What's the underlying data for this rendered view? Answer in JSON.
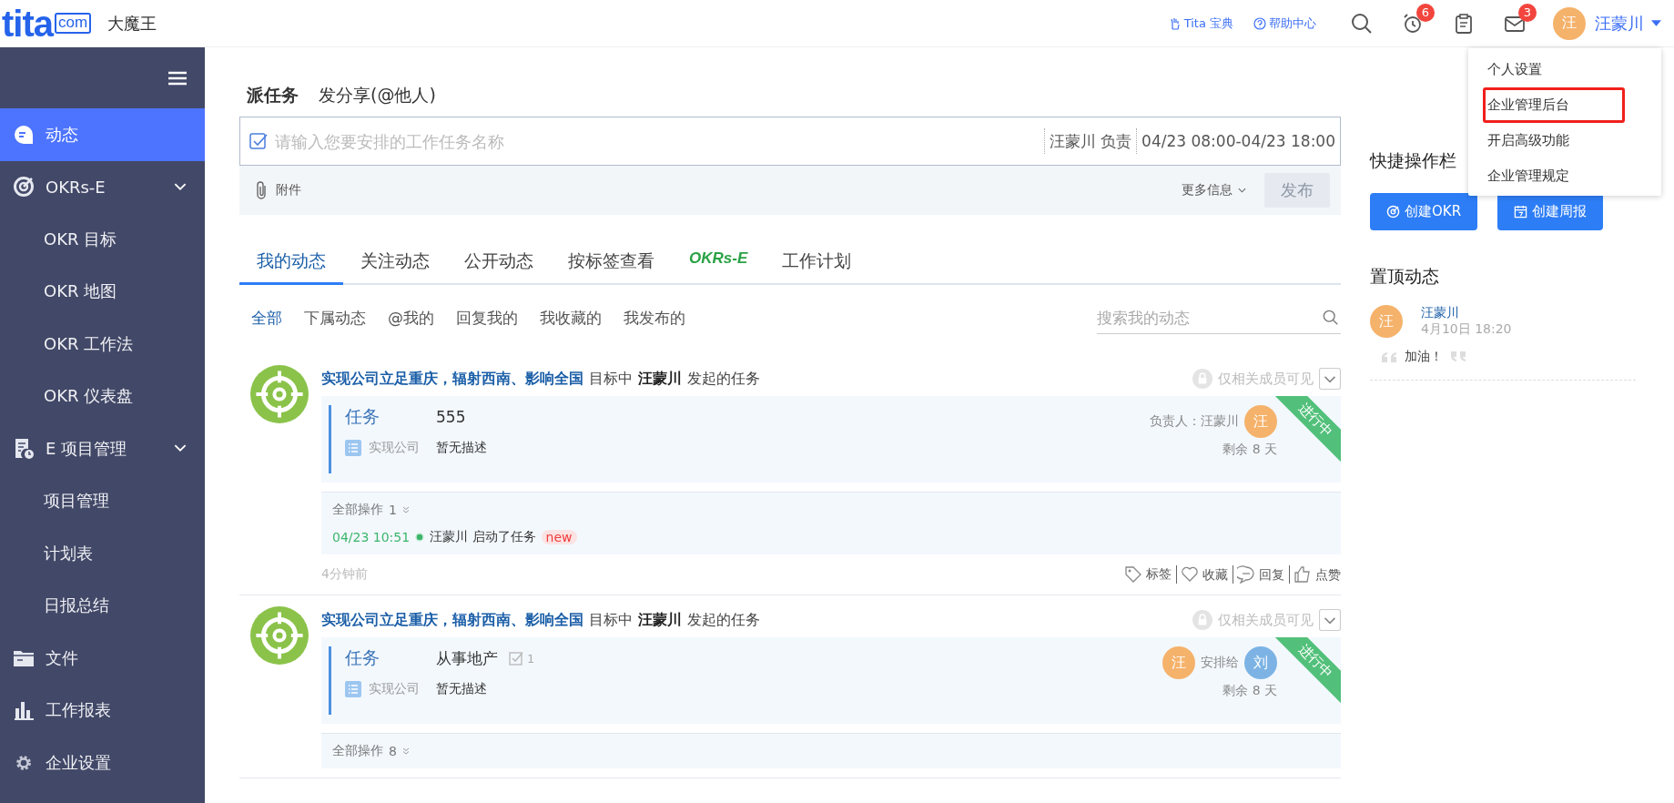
{
  "header": {
    "logo": {
      "main": "tita",
      "boxed": "com"
    },
    "company": "大魔王",
    "links": [
      {
        "kind": "guide",
        "label": "Tita 宝典"
      },
      {
        "kind": "help",
        "label": "帮助中心"
      }
    ],
    "icons": [
      {
        "kind": "search"
      },
      {
        "kind": "alarm",
        "badge": "6"
      },
      {
        "kind": "clipboard"
      },
      {
        "kind": "mail",
        "badge": "3"
      }
    ],
    "user": {
      "avatar": "汪",
      "name": "汪蒙川"
    }
  },
  "user_menu": [
    {
      "label": "个人设置",
      "highlighted": false
    },
    {
      "label": "企业管理后台",
      "highlighted": true
    },
    {
      "label": "开启高级功能",
      "highlighted": false
    },
    {
      "label": "企业管理规定",
      "highlighted": false
    }
  ],
  "sidebar": {
    "items": [
      {
        "kind": "chat",
        "label": "动态",
        "selected": true
      },
      {
        "kind": "target",
        "label": "OKRs-E",
        "selected": false,
        "expanded": true,
        "children": [
          {
            "label": "OKR 目标",
            "selected": false
          },
          {
            "label": "OKR 地图",
            "selected": false
          },
          {
            "label": "OKR 工作法",
            "selected": false
          },
          {
            "label": "OKR 仪表盘",
            "selected": false
          }
        ]
      },
      {
        "kind": "project",
        "label": "E 项目管理",
        "selected": false,
        "expanded": true,
        "children": [
          {
            "label": "项目管理",
            "selected": false
          },
          {
            "label": "计划表",
            "selected": false
          },
          {
            "label": "日报总结",
            "selected": false
          }
        ]
      },
      {
        "kind": "folder",
        "label": "文件",
        "selected": false
      },
      {
        "kind": "chart",
        "label": "工作报表",
        "selected": false
      },
      {
        "kind": "gear",
        "label": "企业设置",
        "selected": false
      }
    ]
  },
  "composer": {
    "tabs": [
      {
        "label": "派任务",
        "selected": true
      },
      {
        "label": "发分享(@他人)",
        "selected": false
      }
    ],
    "placeholder": "请输入您要安排的工作任务名称",
    "owner": "汪蒙川 负责",
    "time": "04/23 08:00-04/23 18:00",
    "attach": "附件",
    "more": "更多信息",
    "submit": {
      "label": "发布",
      "disabled": true
    }
  },
  "feed_tabs": [
    {
      "kind": "text",
      "label": "我的动态",
      "selected": true
    },
    {
      "kind": "text",
      "label": "关注动态",
      "selected": false
    },
    {
      "kind": "text",
      "label": "公开动态",
      "selected": false
    },
    {
      "kind": "text",
      "label": "按标签查看",
      "selected": false
    },
    {
      "kind": "logo",
      "label": "OKRs-E",
      "selected": false
    },
    {
      "kind": "text",
      "label": "工作计划",
      "selected": false
    }
  ],
  "filters": [
    {
      "label": "全部",
      "selected": true
    },
    {
      "label": "下属动态",
      "selected": false
    },
    {
      "label": "@我的",
      "selected": false
    },
    {
      "label": "回复我的",
      "selected": false
    },
    {
      "label": "我收藏的",
      "selected": false
    },
    {
      "label": "我发布的",
      "selected": false
    }
  ],
  "feed_search": {
    "placeholder": "搜索我的动态"
  },
  "posts": [
    {
      "goal": "实现公司立足重庆，辐射西南、影响全国",
      "mid": "目标中",
      "author": "汪蒙川",
      "suffix": "发起的任务",
      "visibility": "仅相关成员可见",
      "type": "任务",
      "title": "555",
      "source": "实现公司",
      "desc": "暂无描述",
      "people": {
        "kind": "owner",
        "label": "负责人：汪蒙川",
        "from": "汪"
      },
      "remaining": "剩余 8 天",
      "status": "进行中",
      "ops": {
        "label": "全部操作",
        "count": "1",
        "log": {
          "time": "04/23 10:51",
          "text": "汪蒙川 启动了任务",
          "badge": "new"
        }
      },
      "ago": "4分钟前",
      "actions": [
        {
          "kind": "tag",
          "label": "标签"
        },
        {
          "kind": "heart",
          "label": "收藏"
        },
        {
          "kind": "reply",
          "label": "回复"
        },
        {
          "kind": "like",
          "label": "点赞"
        }
      ]
    },
    {
      "goal": "实现公司立足重庆，辐射西南、影响全国",
      "mid": "目标中",
      "author": "汪蒙川",
      "suffix": "发起的任务",
      "visibility": "仅相关成员可见",
      "type": "任务",
      "title": "从事地产",
      "checks": "1",
      "source": "实现公司",
      "desc": "暂无描述",
      "people": {
        "kind": "assign",
        "label": "安排给",
        "from": "汪",
        "to": "刘"
      },
      "remaining": "剩余 8 天",
      "status": "进行中",
      "ops": {
        "label": "全部操作",
        "count": "8"
      }
    }
  ],
  "quick": {
    "title": "快捷操作栏",
    "buttons": [
      {
        "kind": "okr",
        "label": "创建OKR"
      },
      {
        "kind": "calendar",
        "label": "创建周报"
      }
    ]
  },
  "pinned": {
    "title": "置顶动态",
    "items": [
      {
        "avatar": "汪",
        "name": "汪蒙川",
        "time": "4月10日 18:20",
        "text": "加油！"
      }
    ]
  }
}
